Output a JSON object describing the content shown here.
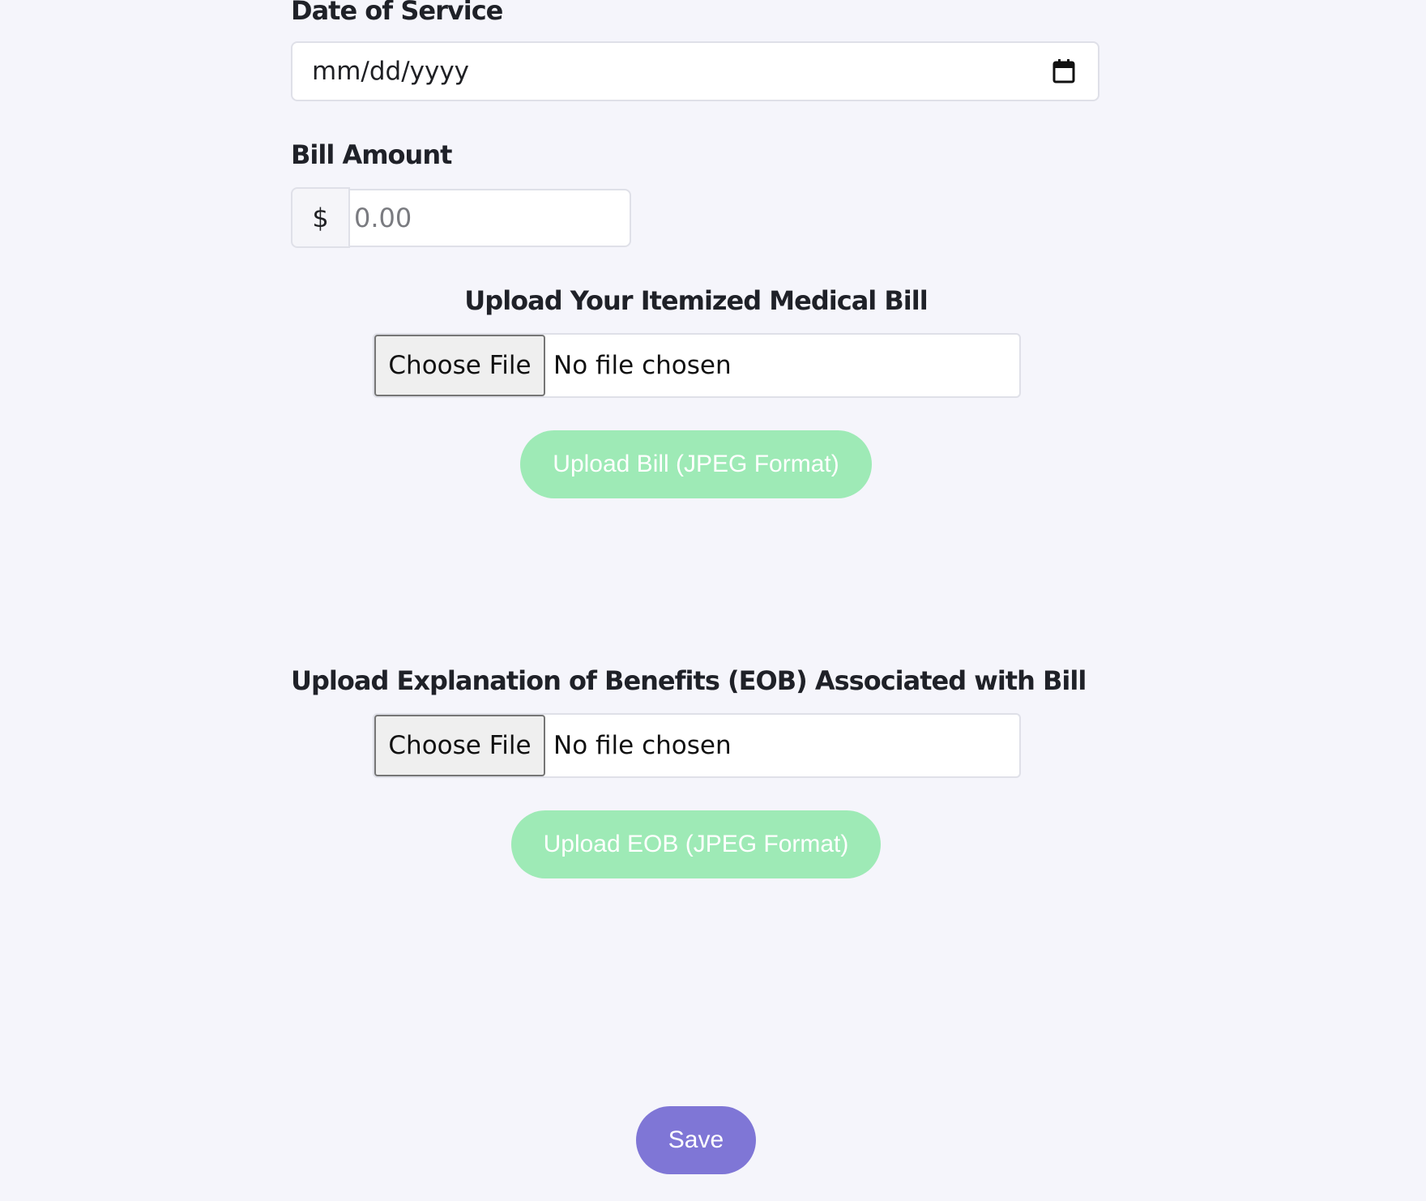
{
  "form": {
    "date_of_service": {
      "label": "Date of Service",
      "placeholder": "mm/dd/yyyy",
      "icon": "calendar-icon"
    },
    "bill_amount": {
      "label": "Bill Amount",
      "currency_symbol": "$",
      "placeholder": "0.00"
    },
    "bill_upload": {
      "label": "Upload Your Itemized Medical Bill",
      "choose_label": "Choose File",
      "status": "No file chosen",
      "button_label": "Upload Bill (JPEG Format)"
    },
    "eob_upload": {
      "label": "Upload Explanation of Benefits (EOB) Associated with Bill",
      "choose_label": "Choose File",
      "status": "No file chosen",
      "button_label": "Upload EOB (JPEG Format)"
    },
    "save_label": "Save"
  },
  "colors": {
    "background": "#f5f5fb",
    "upload_button": "#9eeab6",
    "save_button": "#7f76d6",
    "input_border": "#dfe0e8"
  }
}
